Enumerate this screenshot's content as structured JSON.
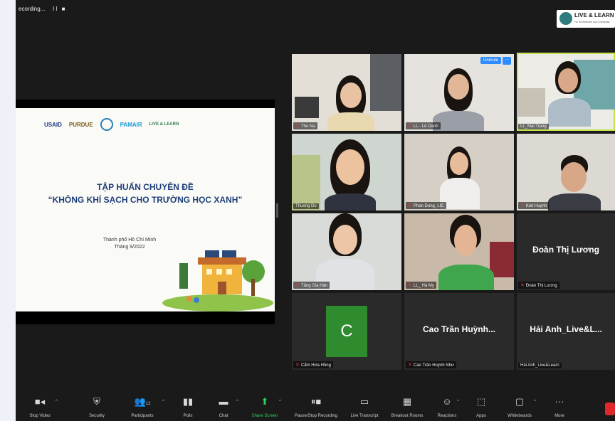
{
  "recording": {
    "label": "ecording...",
    "controls": "II ■"
  },
  "brand_logo": {
    "title": "LIVE & LEARN",
    "subtitle": "For Environment and Community"
  },
  "slide": {
    "partners": [
      "USAID",
      "PURDUE",
      "PAMAIR",
      "LIVE & LEARN"
    ],
    "title_line1": "TẬP HUẤN CHUYÊN ĐỀ",
    "title_line2": "“KHÔNG KHÍ SẠCH CHO TRƯỜNG HỌC XANH”",
    "city": "Thành phố Hồ Chí Minh",
    "month": "Tháng 9/2022"
  },
  "participants": [
    {
      "name": "Thu Na"
    },
    {
      "name": "LL - Lê Oanh",
      "unmute_label": "Unmute",
      "more_label": "···"
    },
    {
      "name": "LL_Mai Trang"
    },
    {
      "name": "Thuong Do"
    },
    {
      "name": "Phan Dung_LIC"
    },
    {
      "name": "Kiet Huynh"
    },
    {
      "name": "Tăng Gia Hân"
    },
    {
      "name": "LL_ Hà My"
    },
    {
      "name": "Đoàn Thị Lương",
      "display": "Đoàn Thị Lương"
    },
    {
      "name": "Cẩm Hứa Hồng",
      "avatar": "C"
    },
    {
      "name": "Cao Trần Huỳnh Như",
      "display": "Cao Trần Huỳnh..."
    },
    {
      "name": "Hải Anh_Live&Learn",
      "display": "Hải Anh_Live&L..."
    }
  ],
  "toolbar": {
    "stop_video": "Stop Video",
    "security": "Security",
    "participants": "Participants",
    "participants_count": "12",
    "polls": "Polls",
    "chat": "Chat",
    "share_screen": "Share Screen",
    "pause_recording": "Pause/Stop Recording",
    "live_transcript": "Live Transcript",
    "breakout_rooms": "Breakout Rooms",
    "reactions": "Reactions",
    "apps": "Apps",
    "whiteboards": "Whiteboards",
    "more": "More"
  },
  "colors": {
    "active_speaker": "#c3e34b",
    "share_green": "#2fd05a",
    "unmute_blue": "#2d8cff",
    "end_red": "#e02828"
  }
}
